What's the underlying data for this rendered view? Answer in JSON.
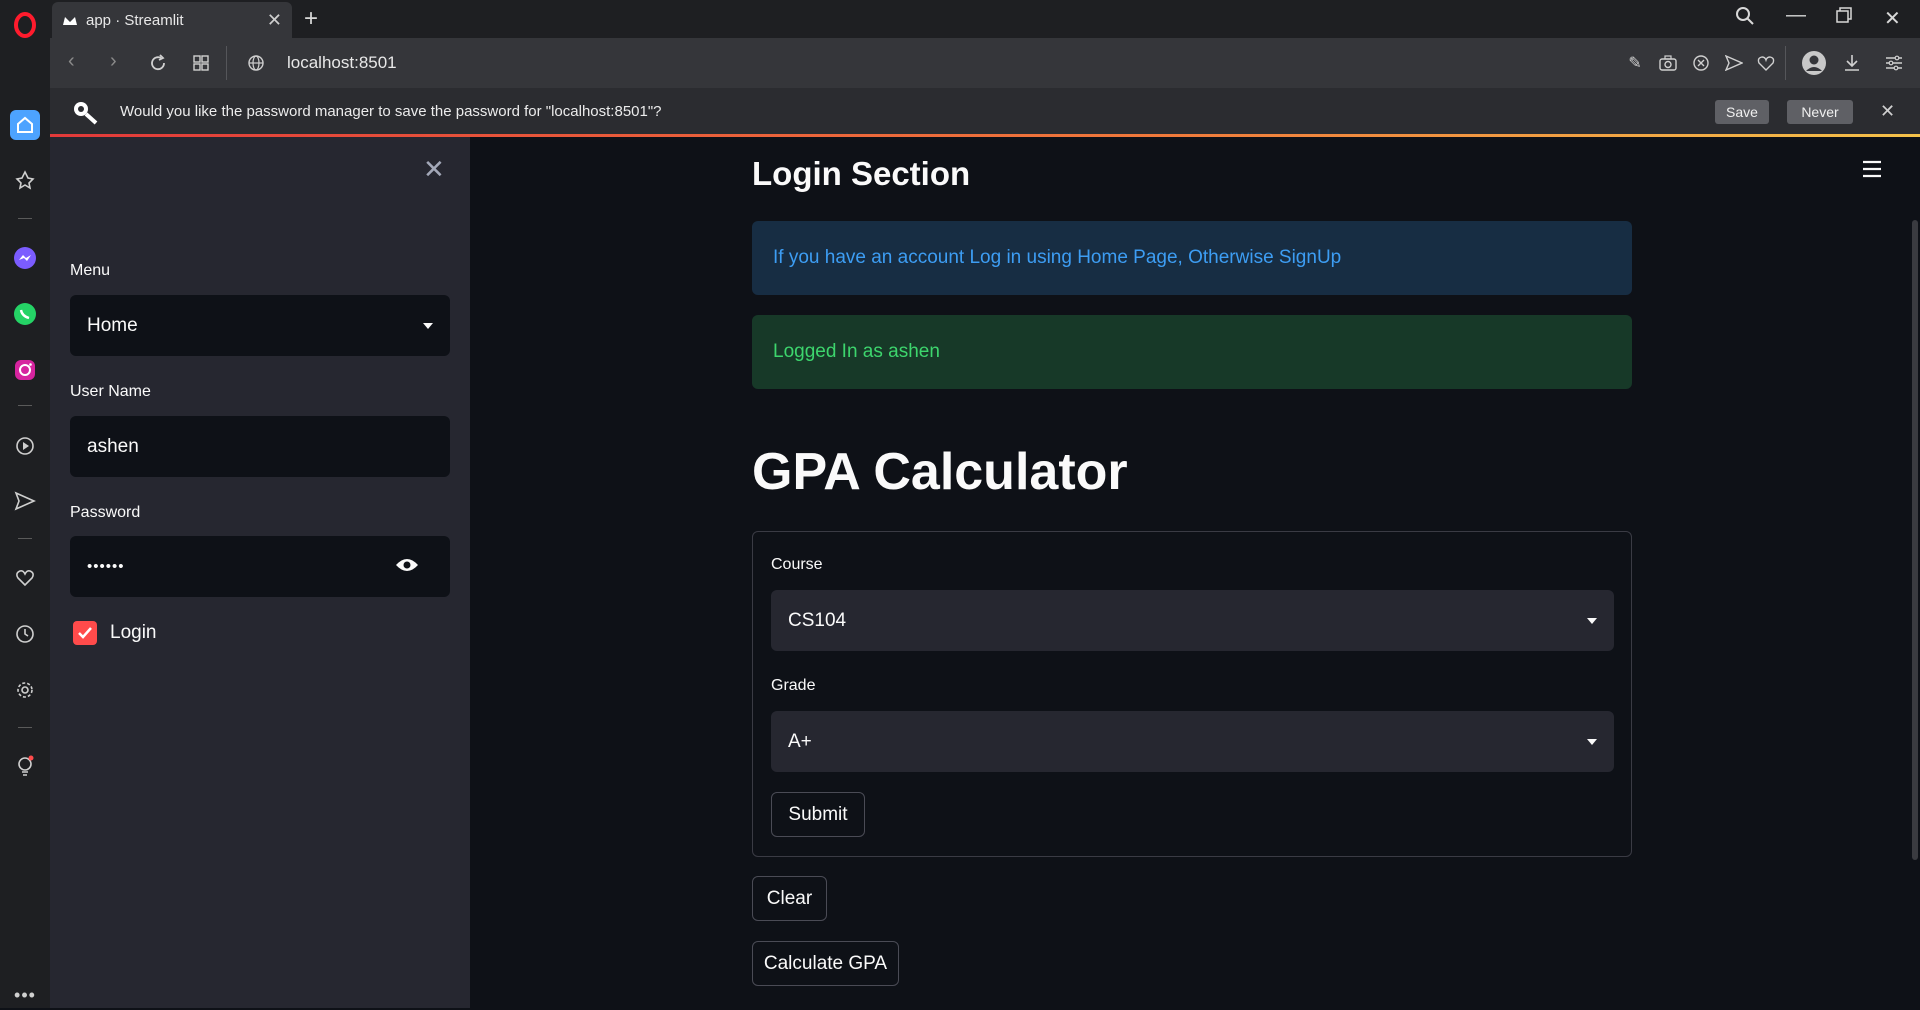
{
  "browser": {
    "tab_title": "app · Streamlit",
    "url": "localhost:8501",
    "password_prompt": "Would you like the password manager to save the password for \"localhost:8501\"?",
    "save_label": "Save",
    "never_label": "Never"
  },
  "sidebar": {
    "menu_label": "Menu",
    "menu_value": "Home",
    "username_label": "User Name",
    "username_value": "ashen",
    "password_label": "Password",
    "password_value": "••••••",
    "login_label": "Login",
    "login_checked": true
  },
  "main": {
    "section_title": "Login Section",
    "info_message": "If you have an account Log in using Home Page, Otherwise SignUp",
    "success_message": "Logged In as ashen",
    "calculator_title": "GPA Calculator",
    "course_label": "Course",
    "course_value": "CS104",
    "grade_label": "Grade",
    "grade_value": "A+",
    "submit_label": "Submit",
    "clear_label": "Clear",
    "calculate_label": "Calculate GPA"
  },
  "colors": {
    "accent": "#ff4b4b",
    "info_text": "#3d9df3",
    "success_text": "#3dd56d"
  }
}
